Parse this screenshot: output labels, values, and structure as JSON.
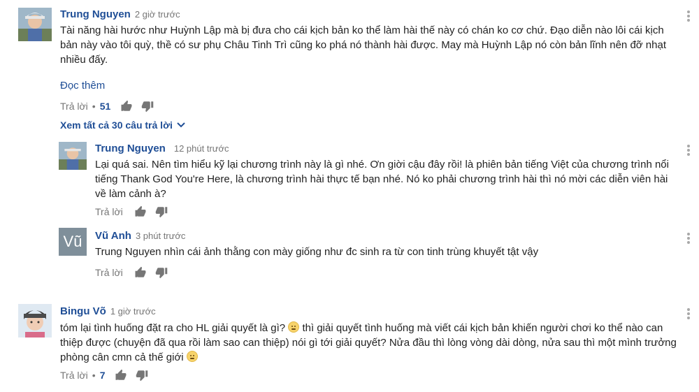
{
  "comments": [
    {
      "author": "Trung Nguyen",
      "time": "2 giờ trước",
      "text": "Tài năng hài hước như Huỳnh Lập mà bị đưa cho cái kịch bản ko thể làm hài thế này có chán ko cơ chứ. Đạo diễn nào lôi cái kịch bản này vào tôi quỳ, thề có sư phụ Châu Tinh Trì cũng ko phá nó thành hài được. May mà Huỳnh Lập nó còn bản lĩnh nên đỡ nhạt nhiều đấy.",
      "read_more": "Đọc thêm",
      "reply_label": "Trả lời",
      "dot": "•",
      "likes": "51",
      "view_replies": "Xem tất cả 30 câu trả lời"
    },
    {
      "author": "Trung Nguyen",
      "time": "12 phút trước",
      "text": "Lại quá sai. Nên tìm hiểu kỹ lại chương trình này là gì nhé. Ơn giời cậu đây rồi! là phiên bản tiếng Việt của chương trình nổi tiếng Thank God You're Here, là chương trình hài thực tế bạn nhé. Nó ko phải chương trình hài thì nó mời các diễn viên hài về làm cảnh à?",
      "reply_label": "Trả lời"
    },
    {
      "author": "Vũ Anh",
      "avatar_letter": "Vũ",
      "time": "3 phút trước",
      "text": "Trung Nguyen nhìn cái ảnh thằng con mày giống như đc sinh ra từ con tinh trùng khuyết tật vậy",
      "reply_label": "Trả lời"
    },
    {
      "author": "Bingu Võ",
      "time": "1 giờ trước",
      "text_a": "tóm lại tình huống đặt ra cho HL giải quyết là gì? ",
      "text_b": " thì giải quyết tình huống mà viết cái kịch bản khiến người chơi ko thể nào can thiệp được (chuyện đã qua rồi làm sao can thiệp) nói gì tới giải quyết? Nửa đầu thì lòng vòng dài dòng, nửa sau thì một mình trưởng phòng cân cmn cả thế giới ",
      "reply_label": "Trả lời",
      "dot": "•",
      "likes": "7"
    }
  ],
  "colors": {
    "author": "#1f4e96",
    "muted": "#767676",
    "text": "#222222"
  },
  "icons": [
    "thumbs-up-icon",
    "thumbs-down-icon",
    "more-vert-icon",
    "chevron-down-icon",
    "emoji-icon"
  ]
}
